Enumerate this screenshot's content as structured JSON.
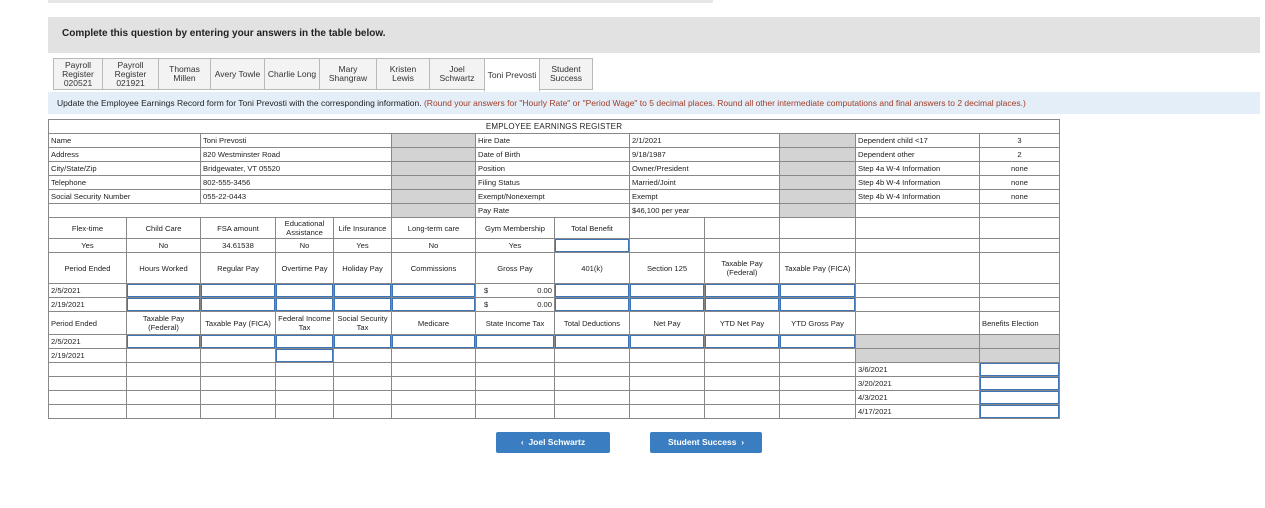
{
  "question": {
    "instruction": "Complete this question by entering your answers in the table below."
  },
  "tabs": [
    "Payroll\nRegister\n020521",
    "Payroll\nRegister\n021921",
    "Thomas\nMillen",
    "Avery Towle",
    "Charlie Long",
    "Mary\nShangraw",
    "Kristen\nLewis",
    "Joel\nSchwartz",
    "Toni Prevosti",
    "Student\nSuccess"
  ],
  "active_tab": 8,
  "prompt": {
    "text": "Update the Employee Earnings Record form for Toni Prevosti with the corresponding information.",
    "hint": "(Round your answers for \"Hourly Rate\" or \"Period Wage\" to 5 decimal places. Round all other intermediate computations and final answers to 2 decimal places.)"
  },
  "register": {
    "title": "EMPLOYEE EARNINGS REGISTER",
    "info_labels": [
      "Name",
      "Address",
      "City/State/Zip",
      "Telephone",
      "Social Security Number"
    ],
    "info_values": [
      "Toni Prevosti",
      "820 Westminster Road",
      "Bridgewater, VT 05520",
      "802-555-3456",
      "055-22-0443"
    ],
    "hire_labels": [
      "Hire Date",
      "Date of Birth",
      "Position",
      "Filing Status",
      "Exempt/Nonexempt",
      "Pay Rate"
    ],
    "hire_values": [
      "2/1/2021",
      "9/18/1987",
      "Owner/President",
      "Married/Joint",
      "Exempt",
      "$46,100 per year"
    ],
    "dep_labels": [
      "Dependent child <17",
      "Dependent other",
      "Step 4a W-4 Information",
      "Step 4b W-4 Information",
      "Step 4b W-4 Information"
    ],
    "dep_values": [
      "3",
      "2",
      "none",
      "none",
      "none"
    ],
    "benefit_headers": [
      "Flex-time",
      "Child Care",
      "FSA amount",
      "Educational Assistance",
      "Life Insurance",
      "Long-term care",
      "Gym Membership",
      "Total Benefit"
    ],
    "benefit_values": [
      "Yes",
      "No",
      "34.61538",
      "No",
      "Yes",
      "No",
      "Yes"
    ],
    "pay_headers": [
      "Period Ended",
      "Hours Worked",
      "Regular Pay",
      "Overtime Pay",
      "Holiday Pay",
      "Commissions",
      "Gross Pay",
      "401(k)",
      "Section 125",
      "Taxable Pay (Federal)",
      "Taxable Pay (FICA)"
    ],
    "pay_periods": [
      "2/5/2021",
      "2/19/2021"
    ],
    "gross_pay": {
      "currency": "$",
      "values": [
        "0.00",
        "0.00"
      ]
    },
    "ded_headers": [
      "Period Ended",
      "Taxable Pay (Federal)",
      "Taxable Pay (FICA)",
      "Federal Income Tax",
      "Social Security Tax",
      "Medicare",
      "State Income Tax",
      "Total Deductions",
      "Net Pay",
      "YTD Net Pay",
      "YTD Gross Pay",
      "",
      "Benefits Election"
    ],
    "ded_periods": [
      "2/5/2021",
      "2/19/2021"
    ],
    "extra_dates": [
      "3/6/2021",
      "3/20/2021",
      "4/3/2021",
      "4/17/2021"
    ]
  },
  "nav": {
    "prev_label": "Joel Schwartz",
    "next_label": "Student Success",
    "prev_icon": "chevron-left-icon",
    "next_icon": "chevron-right-icon"
  },
  "colors": {
    "accent": "#3a7ec1",
    "hint": "#a23d26",
    "info_bar": "#e3eef8",
    "input_border": "#3f74b7"
  }
}
